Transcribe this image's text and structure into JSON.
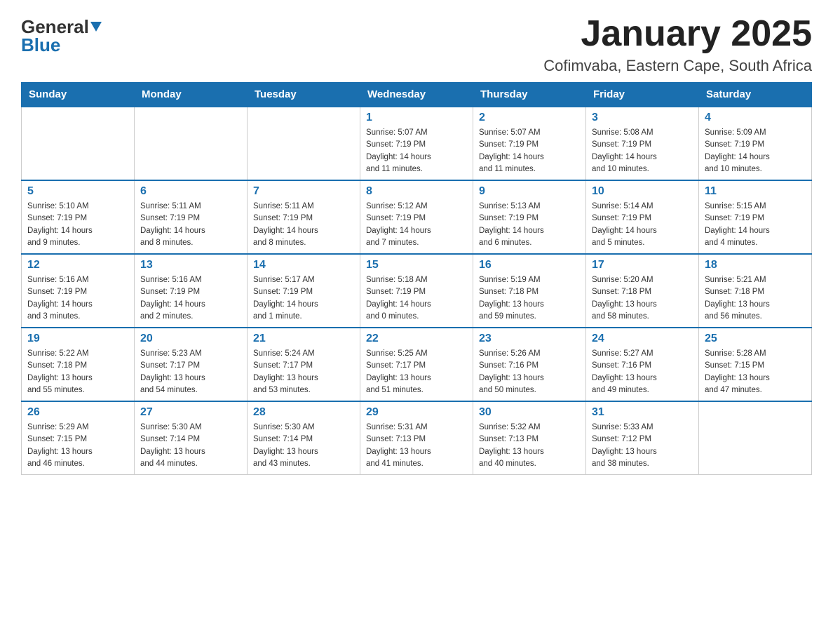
{
  "logo": {
    "text_general": "General",
    "text_blue": "Blue"
  },
  "header": {
    "month_year": "January 2025",
    "location": "Cofimvaba, Eastern Cape, South Africa"
  },
  "weekdays": [
    "Sunday",
    "Monday",
    "Tuesday",
    "Wednesday",
    "Thursday",
    "Friday",
    "Saturday"
  ],
  "weeks": [
    [
      {
        "day": "",
        "info": ""
      },
      {
        "day": "",
        "info": ""
      },
      {
        "day": "",
        "info": ""
      },
      {
        "day": "1",
        "info": "Sunrise: 5:07 AM\nSunset: 7:19 PM\nDaylight: 14 hours\nand 11 minutes."
      },
      {
        "day": "2",
        "info": "Sunrise: 5:07 AM\nSunset: 7:19 PM\nDaylight: 14 hours\nand 11 minutes."
      },
      {
        "day": "3",
        "info": "Sunrise: 5:08 AM\nSunset: 7:19 PM\nDaylight: 14 hours\nand 10 minutes."
      },
      {
        "day": "4",
        "info": "Sunrise: 5:09 AM\nSunset: 7:19 PM\nDaylight: 14 hours\nand 10 minutes."
      }
    ],
    [
      {
        "day": "5",
        "info": "Sunrise: 5:10 AM\nSunset: 7:19 PM\nDaylight: 14 hours\nand 9 minutes."
      },
      {
        "day": "6",
        "info": "Sunrise: 5:11 AM\nSunset: 7:19 PM\nDaylight: 14 hours\nand 8 minutes."
      },
      {
        "day": "7",
        "info": "Sunrise: 5:11 AM\nSunset: 7:19 PM\nDaylight: 14 hours\nand 8 minutes."
      },
      {
        "day": "8",
        "info": "Sunrise: 5:12 AM\nSunset: 7:19 PM\nDaylight: 14 hours\nand 7 minutes."
      },
      {
        "day": "9",
        "info": "Sunrise: 5:13 AM\nSunset: 7:19 PM\nDaylight: 14 hours\nand 6 minutes."
      },
      {
        "day": "10",
        "info": "Sunrise: 5:14 AM\nSunset: 7:19 PM\nDaylight: 14 hours\nand 5 minutes."
      },
      {
        "day": "11",
        "info": "Sunrise: 5:15 AM\nSunset: 7:19 PM\nDaylight: 14 hours\nand 4 minutes."
      }
    ],
    [
      {
        "day": "12",
        "info": "Sunrise: 5:16 AM\nSunset: 7:19 PM\nDaylight: 14 hours\nand 3 minutes."
      },
      {
        "day": "13",
        "info": "Sunrise: 5:16 AM\nSunset: 7:19 PM\nDaylight: 14 hours\nand 2 minutes."
      },
      {
        "day": "14",
        "info": "Sunrise: 5:17 AM\nSunset: 7:19 PM\nDaylight: 14 hours\nand 1 minute."
      },
      {
        "day": "15",
        "info": "Sunrise: 5:18 AM\nSunset: 7:19 PM\nDaylight: 14 hours\nand 0 minutes."
      },
      {
        "day": "16",
        "info": "Sunrise: 5:19 AM\nSunset: 7:18 PM\nDaylight: 13 hours\nand 59 minutes."
      },
      {
        "day": "17",
        "info": "Sunrise: 5:20 AM\nSunset: 7:18 PM\nDaylight: 13 hours\nand 58 minutes."
      },
      {
        "day": "18",
        "info": "Sunrise: 5:21 AM\nSunset: 7:18 PM\nDaylight: 13 hours\nand 56 minutes."
      }
    ],
    [
      {
        "day": "19",
        "info": "Sunrise: 5:22 AM\nSunset: 7:18 PM\nDaylight: 13 hours\nand 55 minutes."
      },
      {
        "day": "20",
        "info": "Sunrise: 5:23 AM\nSunset: 7:17 PM\nDaylight: 13 hours\nand 54 minutes."
      },
      {
        "day": "21",
        "info": "Sunrise: 5:24 AM\nSunset: 7:17 PM\nDaylight: 13 hours\nand 53 minutes."
      },
      {
        "day": "22",
        "info": "Sunrise: 5:25 AM\nSunset: 7:17 PM\nDaylight: 13 hours\nand 51 minutes."
      },
      {
        "day": "23",
        "info": "Sunrise: 5:26 AM\nSunset: 7:16 PM\nDaylight: 13 hours\nand 50 minutes."
      },
      {
        "day": "24",
        "info": "Sunrise: 5:27 AM\nSunset: 7:16 PM\nDaylight: 13 hours\nand 49 minutes."
      },
      {
        "day": "25",
        "info": "Sunrise: 5:28 AM\nSunset: 7:15 PM\nDaylight: 13 hours\nand 47 minutes."
      }
    ],
    [
      {
        "day": "26",
        "info": "Sunrise: 5:29 AM\nSunset: 7:15 PM\nDaylight: 13 hours\nand 46 minutes."
      },
      {
        "day": "27",
        "info": "Sunrise: 5:30 AM\nSunset: 7:14 PM\nDaylight: 13 hours\nand 44 minutes."
      },
      {
        "day": "28",
        "info": "Sunrise: 5:30 AM\nSunset: 7:14 PM\nDaylight: 13 hours\nand 43 minutes."
      },
      {
        "day": "29",
        "info": "Sunrise: 5:31 AM\nSunset: 7:13 PM\nDaylight: 13 hours\nand 41 minutes."
      },
      {
        "day": "30",
        "info": "Sunrise: 5:32 AM\nSunset: 7:13 PM\nDaylight: 13 hours\nand 40 minutes."
      },
      {
        "day": "31",
        "info": "Sunrise: 5:33 AM\nSunset: 7:12 PM\nDaylight: 13 hours\nand 38 minutes."
      },
      {
        "day": "",
        "info": ""
      }
    ]
  ]
}
